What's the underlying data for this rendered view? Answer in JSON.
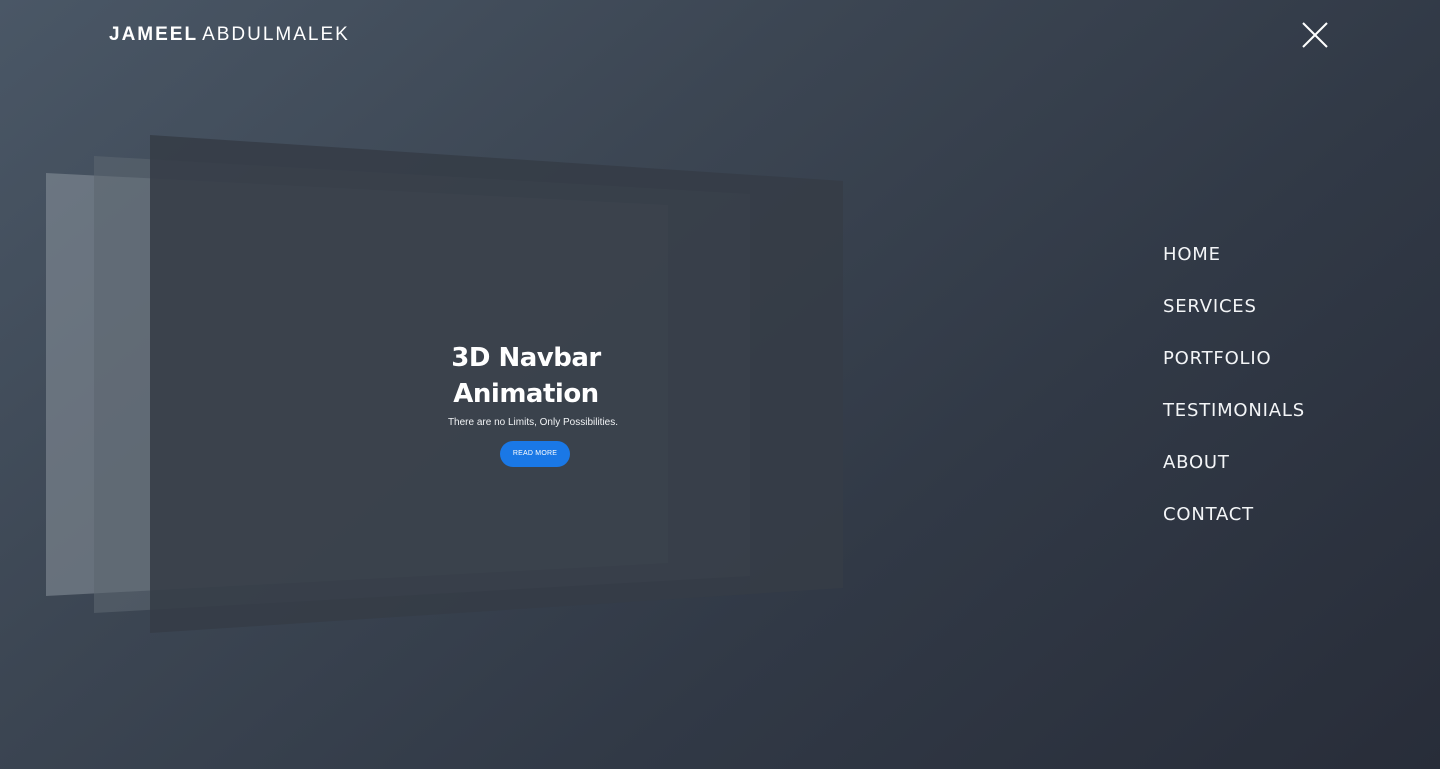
{
  "header": {
    "brand_first": "JAMEEL",
    "brand_last": "ABDULMALEK",
    "close_icon": "close-icon"
  },
  "hero": {
    "title": "3D Navbar Animation",
    "subtitle": "There are no Limits, Only Possibilities.",
    "button_label": "READ MORE"
  },
  "nav": {
    "items": [
      {
        "label": "HOME"
      },
      {
        "label": "SERVICES"
      },
      {
        "label": "PORTFOLIO"
      },
      {
        "label": "TESTIMONIALS"
      },
      {
        "label": "ABOUT"
      },
      {
        "label": "CONTACT"
      }
    ]
  },
  "colors": {
    "accent": "#1a78e6",
    "background_start": "#4a5766",
    "background_end": "#282d39"
  }
}
